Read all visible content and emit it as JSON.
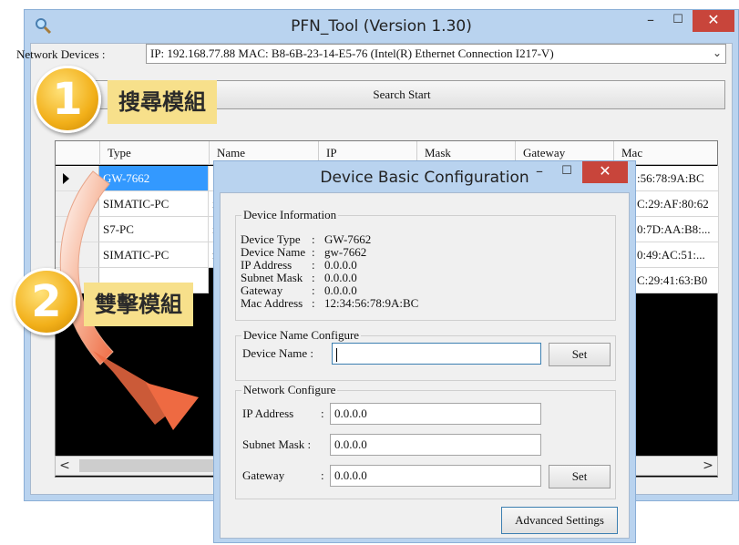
{
  "window": {
    "title": "PFN_Tool (Version 1.30)",
    "controls": {
      "minimize": "–",
      "maximize": "☐",
      "close": "✕"
    }
  },
  "network": {
    "label": "Network Devices :",
    "selected": "IP: 192.168.77.88  MAC: B8-6B-23-14-E5-76 (Intel(R) Ethernet Connection I217-V)",
    "arrow": "⌄"
  },
  "search_button": "Search Start",
  "table": {
    "columns": [
      "Type",
      "Name",
      "IP",
      "Mask",
      "Gateway",
      "Mac"
    ],
    "rows": [
      {
        "type": "GW-7662",
        "name": "",
        "mac": ":56:78:9A:BC",
        "selected": true
      },
      {
        "type": "SIMATIC-PC",
        "name": "i",
        "mac": "C:29:AF:80:62"
      },
      {
        "type": "S7-PC",
        "name": "i",
        "mac": "0:7D:AA:B8:..."
      },
      {
        "type": "SIMATIC-PC",
        "name": "r",
        "mac": "0:49:AC:51:..."
      },
      {
        "type": "",
        "name": "",
        "mac": "C:29:41:63:B0"
      }
    ],
    "scroll": {
      "left": "<",
      "right": ">"
    }
  },
  "annotations": {
    "step1_number": "1",
    "step1_text": "搜尋模組",
    "step2_number": "2",
    "step2_text": "雙擊模組"
  },
  "dialog": {
    "title": "Device Basic Configuration",
    "controls": {
      "minimize": "–",
      "maximize": "☐",
      "close": "✕"
    },
    "device_info": {
      "label": "Device Information",
      "lines": [
        {
          "key": "Device Type",
          "value": "GW-7662"
        },
        {
          "key": "Device Name",
          "value": "gw-7662"
        },
        {
          "key": "IP Address",
          "value": "0.0.0.0"
        },
        {
          "key": "Subnet Mask",
          "value": "0.0.0.0"
        },
        {
          "key": "Gateway",
          "value": "0.0.0.0"
        },
        {
          "key": "Mac Address",
          "value": "12:34:56:78:9A:BC"
        }
      ]
    },
    "name_config": {
      "label": "Device Name Configure",
      "field_label": "Device Name :",
      "value": "",
      "set_label": "Set"
    },
    "network_config": {
      "label": "Network Configure",
      "ip_label": "IP Address",
      "ip_value": "0.0.0.0",
      "mask_label": "Subnet Mask :",
      "mask_value": "0.0.0.0",
      "gateway_label": "Gateway",
      "gateway_value": "0.0.0.0",
      "set_label": "Set"
    },
    "advanced_label": "Advanced Settings"
  },
  "colors": {
    "accent": "#3399ff",
    "close": "#c8453b",
    "badge": "#f2b01a",
    "callout": "#f7e08b"
  }
}
